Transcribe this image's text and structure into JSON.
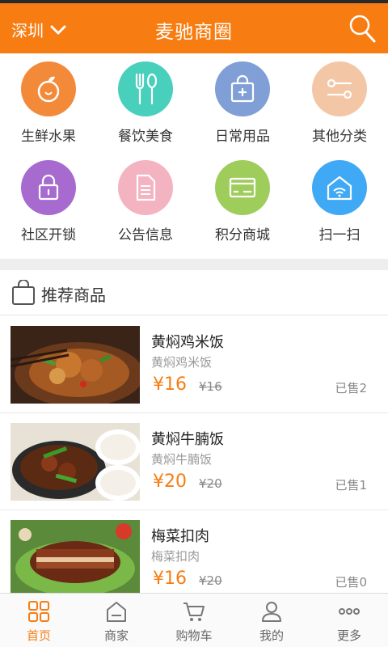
{
  "header": {
    "city": "深圳",
    "title": "麦驰商圈"
  },
  "categories": [
    {
      "label": "生鲜水果",
      "icon": "fruit-icon",
      "color": "#f28a3a"
    },
    {
      "label": "餐饮美食",
      "icon": "cutlery-icon",
      "color": "#49d0bd"
    },
    {
      "label": "日常用品",
      "icon": "shopping-bag-icon",
      "color": "#7f9fd6"
    },
    {
      "label": "其他分类",
      "icon": "tools-icon",
      "color": "#f3c6a5"
    },
    {
      "label": "社区开锁",
      "icon": "lock-icon",
      "color": "#a76bd0"
    },
    {
      "label": "公告信息",
      "icon": "document-icon",
      "color": "#f4b3c1"
    },
    {
      "label": "积分商城",
      "icon": "card-icon",
      "color": "#9fcd5c"
    },
    {
      "label": "扫一扫",
      "icon": "wifi-home-icon",
      "color": "#3fa9f5"
    }
  ],
  "recommend": {
    "title": "推荐商品"
  },
  "products": [
    {
      "name": "黄焖鸡米饭",
      "sub": "黄焖鸡米饭",
      "price": "¥16",
      "old_price": "¥16",
      "sold": "已售2"
    },
    {
      "name": "黄焖牛腩饭",
      "sub": "黄焖牛腩饭",
      "price": "¥20",
      "old_price": "¥20",
      "sold": "已售1"
    },
    {
      "name": "梅菜扣肉",
      "sub": "梅菜扣肉",
      "price": "¥16",
      "old_price": "¥20",
      "sold": "已售0"
    }
  ],
  "tabs": [
    {
      "label": "首页",
      "icon": "home-grid-icon",
      "active": true
    },
    {
      "label": "商家",
      "icon": "store-icon",
      "active": false
    },
    {
      "label": "购物车",
      "icon": "cart-icon",
      "active": false
    },
    {
      "label": "我的",
      "icon": "user-icon",
      "active": false
    },
    {
      "label": "更多",
      "icon": "more-icon",
      "active": false
    }
  ],
  "colors": {
    "brand": "#f77d12",
    "text": "#333333",
    "muted": "#999999"
  }
}
